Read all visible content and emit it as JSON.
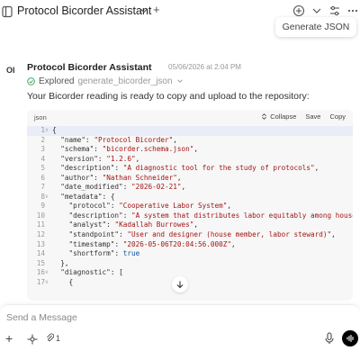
{
  "window": {
    "title": "Protocol Bicorder Assistant",
    "new_tab_symbol": "+"
  },
  "tooltip": {
    "text": "Generate JSON"
  },
  "message": {
    "avatar_initials": "OI",
    "sender": "Protocol Bicorder Assistant",
    "timestamp": "05/06/2026 at 2:04 PM",
    "explored_label": "Explored",
    "explored_file": "generate_bicorder_json",
    "text": "Your Bicorder reading is ready to copy and upload to the repository:"
  },
  "code_block": {
    "language": "json",
    "collapse_label": "Collapse",
    "save_label": "Save",
    "copy_label": "Copy",
    "lines": [
      {
        "n": "1",
        "fold": true,
        "text": "{"
      },
      {
        "n": "2",
        "fold": false,
        "text": "  \"name\": \"Protocol Bicorder\","
      },
      {
        "n": "3",
        "fold": false,
        "text": "  \"schema\": \"bicorder.schema.json\","
      },
      {
        "n": "4",
        "fold": false,
        "text": "  \"version\": \"1.2.6\","
      },
      {
        "n": "5",
        "fold": false,
        "text": "  \"description\": \"A diagnostic tool for the study of protocols\","
      },
      {
        "n": "6",
        "fold": false,
        "text": "  \"author\": \"Nathan Schneider\","
      },
      {
        "n": "7",
        "fold": false,
        "text": "  \"date_modified\": \"2026-02-21\","
      },
      {
        "n": "8",
        "fold": true,
        "text": "  \"metadata\": {"
      },
      {
        "n": "9",
        "fold": false,
        "text": "    \"protocol\": \"Cooperative Labor System\","
      },
      {
        "n": "10",
        "fold": false,
        "text": "    \"description\": \"A system that distributes labor equitably among housema"
      },
      {
        "n": "11",
        "fold": false,
        "text": "    \"analyst\": \"Kadallah Burrowes\","
      },
      {
        "n": "12",
        "fold": false,
        "text": "    \"standpoint\": \"User and designer (house member, labor steward)\","
      },
      {
        "n": "13",
        "fold": false,
        "text": "    \"timestamp\": \"2026-05-06T20:04:56.000Z\","
      },
      {
        "n": "14",
        "fold": false,
        "text": "    \"shortform\": true"
      },
      {
        "n": "15",
        "fold": false,
        "text": "  },"
      },
      {
        "n": "16",
        "fold": true,
        "text": "  \"diagnostic\": ["
      },
      {
        "n": "17",
        "fold": true,
        "text": "    {"
      }
    ]
  },
  "composer": {
    "placeholder": "Send a Message",
    "attach_count": "1"
  }
}
